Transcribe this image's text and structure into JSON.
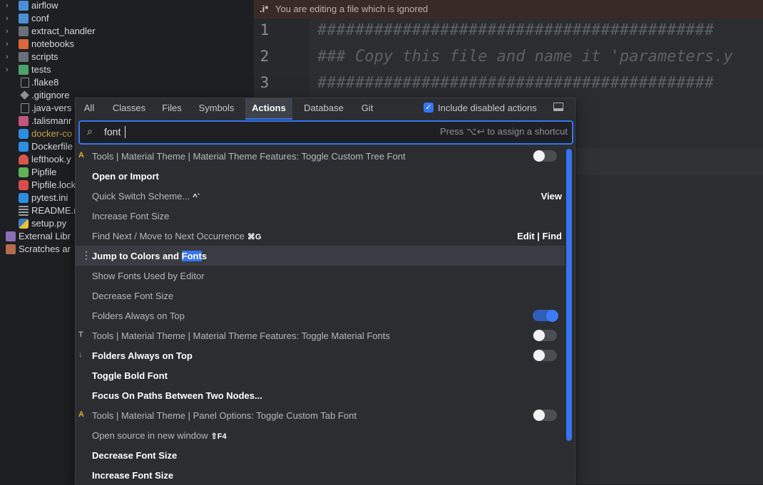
{
  "tree": {
    "items": [
      {
        "label": "airflow",
        "icon": "folder-airflow-icon",
        "chev": true
      },
      {
        "label": "conf",
        "icon": "folder-config-icon",
        "chev": true
      },
      {
        "label": "extract_handler",
        "icon": "folder-icon",
        "chev": true
      },
      {
        "label": "notebooks",
        "icon": "folder-notebooks-icon",
        "chev": true
      },
      {
        "label": "scripts",
        "icon": "folder-icon",
        "chev": true
      },
      {
        "label": "tests",
        "icon": "folder-tests-icon",
        "chev": true
      },
      {
        "label": ".flake8",
        "icon": "file-icon",
        "chev": false
      },
      {
        "label": ".gitignore",
        "icon": "git-icon",
        "chev": false
      },
      {
        "label": ".java-vers",
        "icon": "file-icon",
        "chev": false
      },
      {
        "label": ".talismanr",
        "icon": "yaml-icon",
        "chev": false
      },
      {
        "label": "docker-co",
        "icon": "docker-icon",
        "chev": false
      },
      {
        "label": "Dockerfile",
        "icon": "docker-icon",
        "chev": false
      },
      {
        "label": "lefthook.y",
        "icon": "lefthook-icon",
        "chev": false
      },
      {
        "label": "Pipfile",
        "icon": "pipfile-icon",
        "chev": false
      },
      {
        "label": "Pipfile.lock",
        "icon": "lock-icon",
        "chev": false
      },
      {
        "label": "pytest.ini",
        "icon": "pytest-icon",
        "chev": false
      },
      {
        "label": "README.r",
        "icon": "readme-icon",
        "chev": false
      },
      {
        "label": "setup.py",
        "icon": "python-icon",
        "chev": false
      },
      {
        "label": "External Libr",
        "icon": "libraries-icon",
        "chev": true
      },
      {
        "label": "Scratches ar",
        "icon": "scratches-icon",
        "chev": true
      }
    ]
  },
  "editor": {
    "banner_prefix": ".i*",
    "banner_text": "You are editing a file which is ignored",
    "lines": [
      {
        "num": "1",
        "text": "##########################################"
      },
      {
        "num": "2",
        "text": "### Copy this file and name it 'parameters.y"
      },
      {
        "num": "3",
        "text": "##########################################"
      }
    ]
  },
  "popup": {
    "tabs": [
      "All",
      "Classes",
      "Files",
      "Symbols",
      "Actions",
      "Database",
      "Git"
    ],
    "active_tab": "Actions",
    "include_disabled_label": "Include disabled actions",
    "include_disabled_checked": true,
    "search_value": "font",
    "search_hint": "Press ⌥↩ to assign a shortcut",
    "results": [
      {
        "text": "Tools | Material Theme | Material Theme Features: Toggle Custom Tree Font",
        "icon": "font-a-icon",
        "style": "dim",
        "toggle": "off"
      },
      {
        "text": "Open or Import",
        "style": "bright"
      },
      {
        "text": "Quick Switch Scheme...",
        "shortcut": "^`",
        "right": "View",
        "style": "dim"
      },
      {
        "text": "Increase Font Size",
        "style": "dim"
      },
      {
        "text": "Find Next / Move to Next Occurrence",
        "shortcut": "⌘G",
        "right": "Edit | Find",
        "style": "dim"
      },
      {
        "text_before": "Jump to Colors and ",
        "text_hl": "Font",
        "text_after": "s",
        "style": "bright",
        "selected": true
      },
      {
        "text": "Show Fonts Used by Editor",
        "style": "dim"
      },
      {
        "text": "Decrease Font Size",
        "style": "dim"
      },
      {
        "text": "Folders Always on Top",
        "style": "dim",
        "toggle": "on"
      },
      {
        "text": "Tools | Material Theme | Material Theme Features: Toggle Material Fonts",
        "icon": "font-size-icon",
        "style": "dim",
        "toggle": "off"
      },
      {
        "text": "Folders Always on Top",
        "icon": "sort-icon",
        "style": "bright",
        "toggle": "off"
      },
      {
        "text": "Toggle Bold Font",
        "style": "bright"
      },
      {
        "text": "Focus On Paths Between Two Nodes...",
        "style": "bright"
      },
      {
        "text": "Tools | Material Theme | Panel Options: Toggle Custom Tab Font",
        "icon": "font-a-icon",
        "style": "dim",
        "toggle": "off"
      },
      {
        "text": "Open source in new window",
        "shortcut": "⇧F4",
        "style": "dim"
      },
      {
        "text": "Decrease Font Size",
        "style": "bright"
      },
      {
        "text": "Increase Font Size",
        "style": "bright"
      }
    ]
  },
  "colors": {
    "accent": "#3574f0",
    "banner_bg": "#3a2a27",
    "popup_bg": "#2b2d31"
  }
}
